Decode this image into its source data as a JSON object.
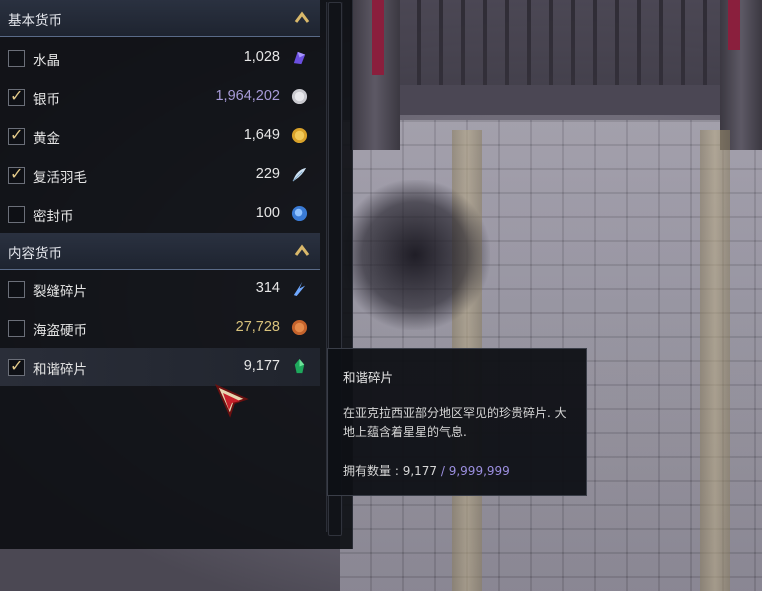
{
  "sections": [
    {
      "title": "基本货币",
      "collapse_icon": "chevron-up-icon",
      "items": [
        {
          "name": "水晶",
          "value": "1,028",
          "checked": false,
          "icon": "crystal-icon",
          "value_color": "#e6e6e6"
        },
        {
          "name": "银币",
          "value": "1,964,202",
          "checked": true,
          "icon": "silver-coin-icon",
          "value_color": "#a79bd8"
        },
        {
          "name": "黄金",
          "value": "1,649",
          "checked": true,
          "icon": "gold-coin-icon",
          "value_color": "#e6e6e6"
        },
        {
          "name": "复活羽毛",
          "value": "229",
          "checked": true,
          "icon": "feather-icon",
          "value_color": "#e6e6e6"
        },
        {
          "name": "密封币",
          "value": "100",
          "checked": false,
          "icon": "sealed-coin-icon",
          "value_color": "#e6e6e6"
        }
      ]
    },
    {
      "title": "内容货币",
      "collapse_icon": "chevron-up-icon",
      "items": [
        {
          "name": "裂缝碎片",
          "value": "314",
          "checked": false,
          "icon": "rift-shard-icon",
          "value_color": "#e6e6e6"
        },
        {
          "name": "海盗硬币",
          "value": "27,728",
          "checked": false,
          "icon": "pirate-coin-icon",
          "value_color": "#d8c27c"
        },
        {
          "name": "和谐碎片",
          "value": "9,177",
          "checked": true,
          "icon": "harmony-shard-icon",
          "value_color": "#e6e6e6"
        }
      ]
    }
  ],
  "check_glyph": "✓",
  "tooltip": {
    "title": "和谐碎片",
    "description": "在亚克拉西亚部分地区罕见的珍贵碎片. 大地上蕴含着星星的气息.",
    "owned_label": "拥有数量 : ",
    "owned_value": "9,177",
    "separator": " / ",
    "owned_max": "9,999,999"
  },
  "colors": {
    "accent_gold": "#e3c98a",
    "max_purple": "#9c8fe0",
    "panel_bg": "#0d0f14"
  }
}
